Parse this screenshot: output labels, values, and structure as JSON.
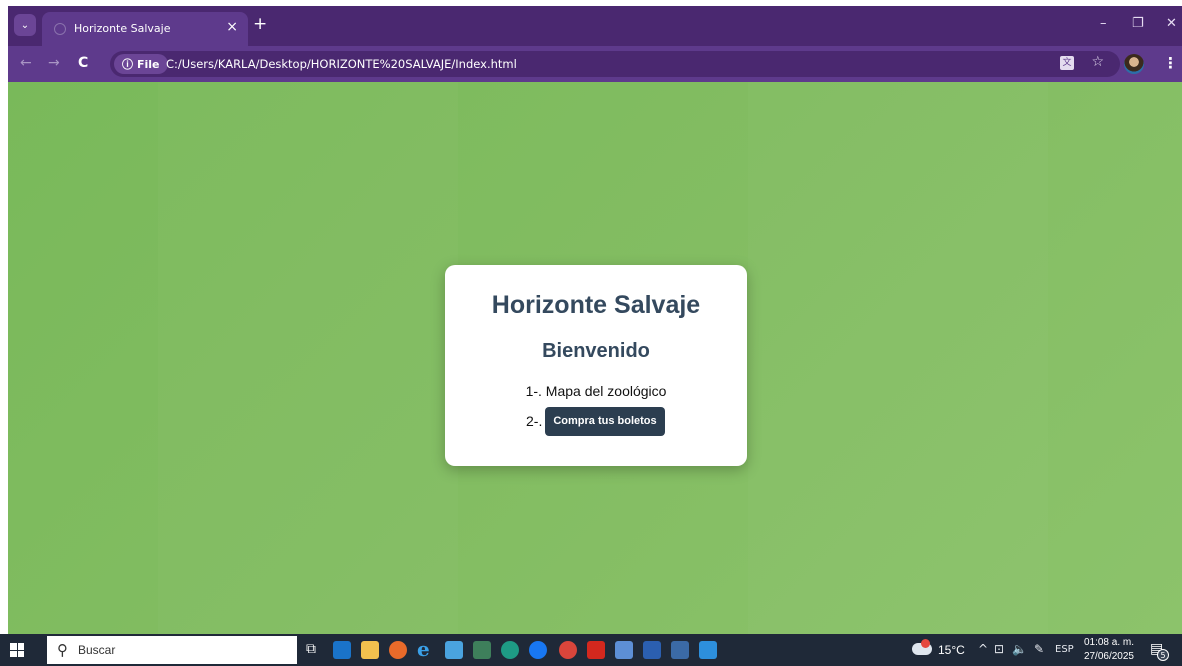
{
  "browser": {
    "tab_title": "Horizonte Salvaje",
    "tab_close": "×",
    "new_tab": "+",
    "site_chip": "File",
    "url": "C:/Users/KARLA/Desktop/HORIZONTE%20SALVAJE/Index.html",
    "window_controls": {
      "minimize": "–",
      "restore": "❐",
      "close": "✕"
    },
    "nav": {
      "back": "←",
      "forward": "→",
      "reload": "C"
    }
  },
  "page": {
    "title": "Horizonte Salvaje",
    "subtitle": "Bienvenido",
    "list": [
      {
        "prefix": "1-.",
        "text": "Mapa del zoológico"
      },
      {
        "prefix": "2-.",
        "button": "Compra tus boletos"
      }
    ],
    "background_color": "#83bd62",
    "card_text_color": "#34495e",
    "button_color": "#2c3e50"
  },
  "taskbar": {
    "search_placeholder": "Buscar",
    "weather": "15°C",
    "language": "ESP",
    "time": "01:08 a. m.",
    "date": "27/06/2025",
    "notifications": "5",
    "pinned_icons": [
      "task-view-icon",
      "outlook-icon",
      "file-explorer-icon",
      "firefox-icon",
      "internet-explorer-icon",
      "paint-icon",
      "calculator-icon",
      "edge-icon",
      "facebook-icon",
      "chrome-icon",
      "acrobat-icon",
      "app-icon",
      "word-icon",
      "visio-icon",
      "vscode-icon"
    ]
  },
  "colors": {
    "tabstrip": "#4a2870",
    "toolbar": "#5e3a8c",
    "taskbar": "#1f2938"
  }
}
